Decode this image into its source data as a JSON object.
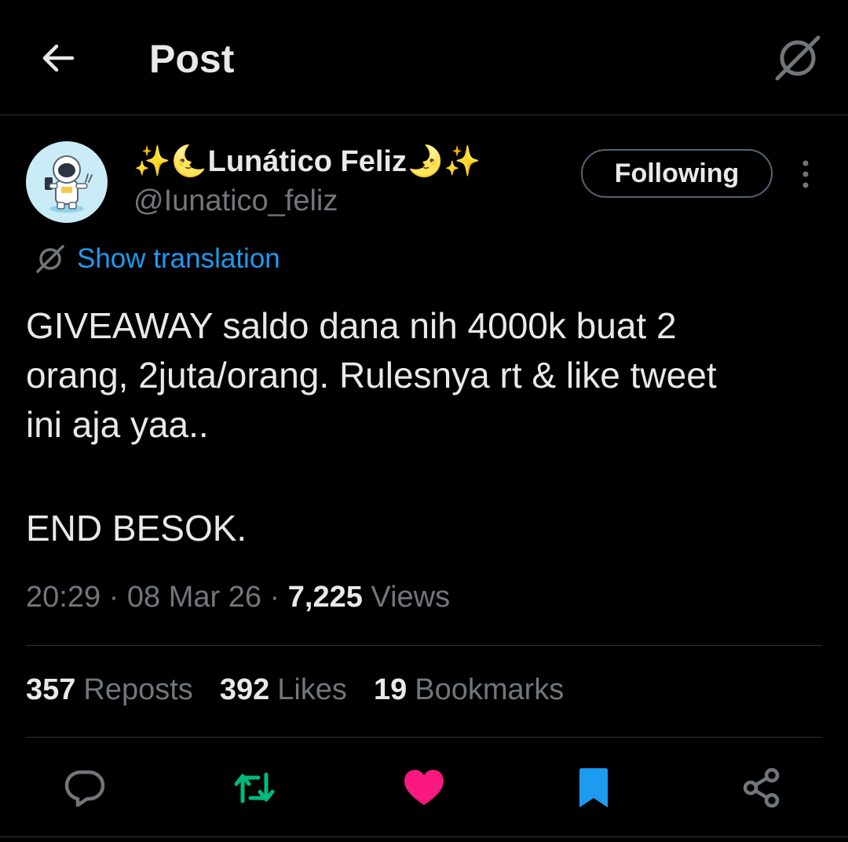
{
  "header": {
    "title": "Post"
  },
  "author": {
    "display_name": "✨🌜Lunático Feliz🌛✨",
    "handle": "@Iunatico_feliz",
    "follow_label": "Following"
  },
  "translation": {
    "label": "Show translation"
  },
  "tweet": {
    "lines": [
      "GIVEAWAY saldo dana nih 4000k buat 2",
      "orang, 2juta/orang. Rulesnya rt & like tweet",
      "ini aja yaa.."
    ],
    "end_line": "END BESOK."
  },
  "meta": {
    "time": "20:29",
    "date": "08 Mar 26",
    "views_count": "7,225",
    "views_label": "Views",
    "separator": "·"
  },
  "stats": {
    "reposts_count": "357",
    "reposts_label": "Reposts",
    "likes_count": "392",
    "likes_label": "Likes",
    "bookmarks_count": "19",
    "bookmarks_label": "Bookmarks"
  },
  "colors": {
    "background": "#000000",
    "link": "#1d9bf0",
    "repost": "#00ba7c",
    "like": "#f91880",
    "bookmark": "#1d9bf0",
    "muted": "#71767b"
  },
  "icons": {
    "back": "arrow-left-icon",
    "grok": "grok-icon",
    "more": "more-vertical-icon",
    "reply": "reply-icon",
    "repost": "repost-icon",
    "like": "heart-icon",
    "bookmark": "bookmark-icon",
    "share": "share-icon"
  }
}
